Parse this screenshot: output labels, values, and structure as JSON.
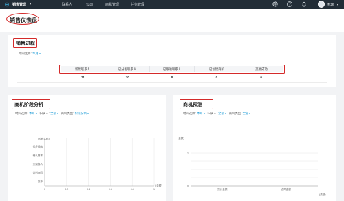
{
  "nav": {
    "app_name": "销售管理",
    "items": [
      "联系人",
      "公司",
      "商机管理",
      "任务管理"
    ],
    "username": "林琳"
  },
  "page": {
    "title": "销售仪表盘"
  },
  "pipeline": {
    "title": "销售进程",
    "time_label": "时间选择:",
    "time_value": "本月",
    "columns": [
      "新建联系人",
      "已分配联系人",
      "已跟进联系人",
      "已创建商机",
      "交易成功"
    ],
    "values": [
      "71",
      "70",
      "8",
      "0",
      "0"
    ]
  },
  "stage_panel": {
    "title": "商机阶段分析",
    "time_label": "时间选择:",
    "time_value": "本月",
    "owner_label": "归属人:",
    "owner_value": "全部",
    "type_label": "商机类型:",
    "type_value": "阶段分析"
  },
  "forecast_panel": {
    "title": "商机预测",
    "time_label": "时间选择:",
    "time_value": "本月",
    "owner_label": "归属人:",
    "owner_value": "全部",
    "type_label": "商机类型:",
    "type_value": "全部"
  },
  "chart_data": [
    {
      "type": "bar",
      "orientation": "horizontal",
      "ylabel": "(阶段名称)",
      "xlabel": "(金额)",
      "categories": [
        "初步接触",
        "确认需求",
        "方案报价",
        "谈判合同",
        "赢单"
      ],
      "x_ticks": [
        "0",
        "0.2",
        "0.4",
        "0.6",
        "0.8",
        "1"
      ],
      "xlim": [
        0,
        1
      ],
      "values": [
        0,
        0,
        0,
        0,
        0
      ],
      "grid": true
    },
    {
      "type": "bar",
      "ylabel": "(金额)",
      "xlabel": "(类型)",
      "categories": [
        "预计金额",
        "合同金额"
      ],
      "y_ticks": [
        "0",
        "1"
      ],
      "ylim": [
        0,
        1
      ],
      "values": [
        0,
        0
      ],
      "grid": true
    }
  ],
  "colors": {
    "nav_bg": "#222d37",
    "accent": "#1a9ad6",
    "highlight": "#d42a2a"
  }
}
